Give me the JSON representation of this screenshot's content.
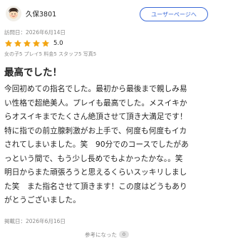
{
  "reviewer": {
    "name": "久保3801",
    "avatar_icon": "smiling-face-icon"
  },
  "user_page_button": "ユーザーページへ",
  "visit_date": "訪問日：2026年6月14日",
  "rating": {
    "stars": 5,
    "max": 5,
    "value_label": "5.0",
    "star_color": "#f3a614"
  },
  "sub_ratings": "女の子5 プレイ5 料金5 スタッフ5 写真5",
  "review": {
    "title": "最高でした！",
    "lines": [
      "今回初めての指名でした。最初から最後まで親しみ易",
      "い性格で超絶美人。プレイも最高でした。メスイキか",
      "らオスイキまでたくさん絶頂させて頂き大満足です！",
      "特に指での前立腺刺激がお上手で、何度も何度もイカ",
      "されてしまいました。笑　90分でのコースでしたがあ",
      "っという間で、もう少し長めでもよかったかな。。笑",
      "明日からまた頑張ろうと思えるくらいスッキリしまし",
      "た笑　また指名させて頂きます！この度はどうもあり",
      "がとうございました。"
    ]
  },
  "posted_date": "掲載日：2026年6月16日",
  "helpful": {
    "label": "参考になった",
    "count": "0"
  },
  "colors": {
    "accent": "#3b6ad8",
    "muted_text": "#8a8a8a"
  }
}
